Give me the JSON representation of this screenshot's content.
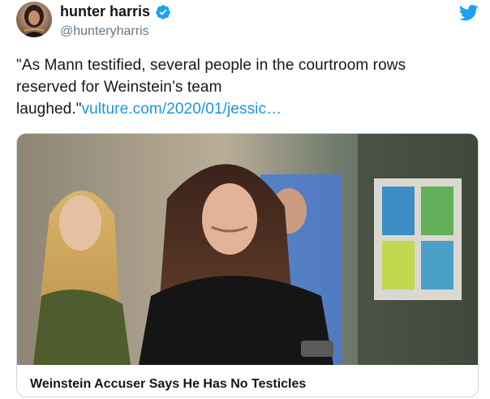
{
  "author": {
    "display_name": "hunter harris",
    "handle": "@hunteryharris",
    "verified": true,
    "avatar_icon": "user-avatar"
  },
  "tweet": {
    "text": "\"As Mann testified, several people in the courtroom rows reserved for Weinstein’s team laughed.\"",
    "link_text": "vulture.com/2020/01/jessic…"
  },
  "card": {
    "title": "Weinstein Accuser Says He Has No Testicles",
    "image_icon": "courtroom-photo"
  },
  "brand": {
    "icon": "twitter-bird-icon",
    "link_color": "#1b95e0",
    "bird_color": "#1da1f2",
    "verified_color": "#1da1f2"
  }
}
